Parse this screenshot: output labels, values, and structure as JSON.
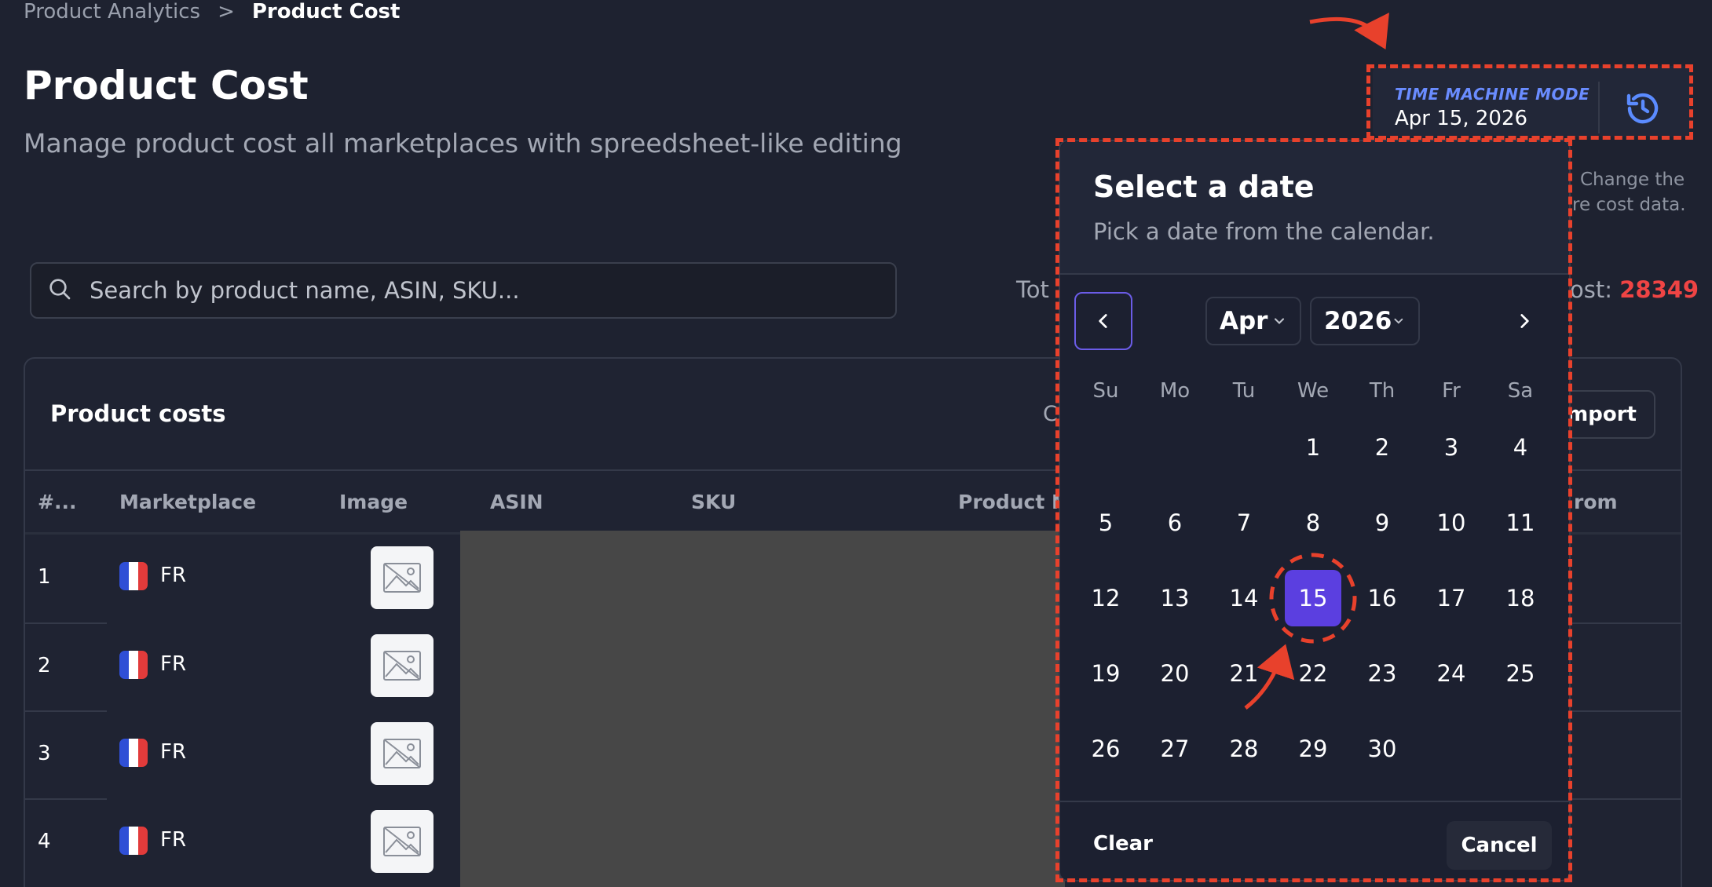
{
  "breadcrumb": {
    "parent": "Product Analytics",
    "separator": ">",
    "current": "Product Cost"
  },
  "page": {
    "title": "Product Cost",
    "subtitle": "Manage product cost all marketplaces with spreedsheet-like editing"
  },
  "search": {
    "placeholder": "Search by product name, ASIN, SKU...",
    "icon": "search-icon"
  },
  "summary": {
    "total_label": "Tot",
    "cost_label": "ost: ",
    "cost_value": "28349"
  },
  "time_machine": {
    "label": "TIME MACHINE MODE",
    "date": "Apr 15, 2026",
    "icon": "history-icon"
  },
  "hint": {
    "line1": "Change the",
    "line2": "re cost data."
  },
  "card": {
    "title": "Product costs",
    "title_trunc": "C",
    "import_label": "Import",
    "columns": {
      "index": "#...",
      "marketplace": "Marketplace",
      "image": "Image",
      "asin": "ASIN",
      "sku": "SKU",
      "product_name": "Product N",
      "from": "rom"
    },
    "rows": [
      {
        "index": "1",
        "marketplace": "FR"
      },
      {
        "index": "2",
        "marketplace": "FR"
      },
      {
        "index": "3",
        "marketplace": "FR"
      },
      {
        "index": "4",
        "marketplace": "FR"
      }
    ]
  },
  "date_picker": {
    "title": "Select a date",
    "subtitle": "Pick a date from the calendar.",
    "month": "Apr",
    "year": "2026",
    "weekdays": [
      "Su",
      "Mo",
      "Tu",
      "We",
      "Th",
      "Fr",
      "Sa"
    ],
    "weeks": [
      [
        "",
        "",
        "",
        "1",
        "2",
        "3",
        "4"
      ],
      [
        "5",
        "6",
        "7",
        "8",
        "9",
        "10",
        "11"
      ],
      [
        "12",
        "13",
        "14",
        "15",
        "16",
        "17",
        "18"
      ],
      [
        "19",
        "20",
        "21",
        "22",
        "23",
        "24",
        "25"
      ],
      [
        "26",
        "27",
        "28",
        "29",
        "30",
        "",
        ""
      ]
    ],
    "selected_day": "15",
    "clear_label": "Clear",
    "cancel_label": "Cancel"
  },
  "colors": {
    "accent": "#5b3fe0",
    "annotation": "#e8412c",
    "cost_value": "#ef4444",
    "tm_label": "#6a8cff"
  }
}
